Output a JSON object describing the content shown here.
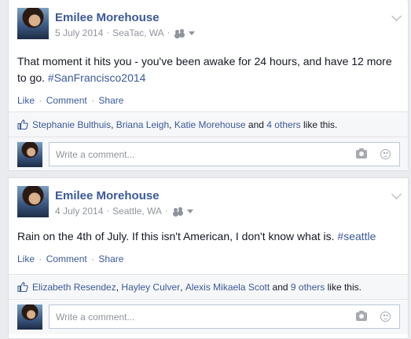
{
  "posts": [
    {
      "author": "Emilee Morehouse",
      "date": "5 July 2014",
      "location": "SeaTac, WA",
      "text": "That moment it hits you - you've been awake for 24 hours, and have 12 more to go. ",
      "hashtag": "#SanFrancisco2014",
      "actions": {
        "like": "Like",
        "comment": "Comment",
        "share": "Share"
      },
      "likers": [
        "Stephanie Bulthuis",
        "Briana Leigh",
        "Katie Morehouse"
      ],
      "and_text": "and",
      "others": "4 others",
      "like_suffix": "like this.",
      "comment_placeholder": "Write a comment..."
    },
    {
      "author": "Emilee Morehouse",
      "date": "4 July 2014",
      "location": "Seattle, WA",
      "text": "Rain on the 4th of July. If this isn't American, I don't know what is. ",
      "hashtag": "#seattle",
      "actions": {
        "like": "Like",
        "comment": "Comment",
        "share": "Share"
      },
      "likers": [
        "Elizabeth Resendez",
        "Hayley Culver",
        "Alexis Mikaela Scott"
      ],
      "and_text": "and",
      "others": "9 others",
      "like_suffix": "like this.",
      "comment_placeholder": "Write a comment..."
    }
  ],
  "separators": {
    "meta_dot": "·",
    "action_dot": "·",
    "comma": ","
  },
  "colors": {
    "link": "#3b5998",
    "meta": "#90949c",
    "background": "#e9ebee"
  }
}
